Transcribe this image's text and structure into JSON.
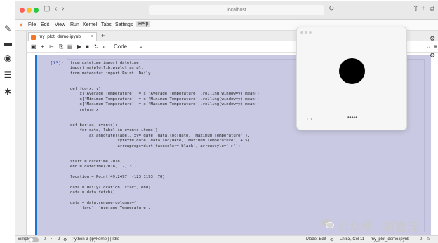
{
  "browser": {
    "address": "localhost"
  },
  "menu": [
    "File",
    "Edit",
    "View",
    "Run",
    "Kernel",
    "Tabs",
    "Settings",
    "Help"
  ],
  "tab": {
    "title": "my_plot_demo.ipynb",
    "close": "×",
    "add": "+"
  },
  "toolbar": {
    "cell_type": "Code"
  },
  "cell": {
    "prompt": "[13]:",
    "lines": [
      "from datetime import datetime",
      "import matplotlib.pyplot as plt",
      "from meteostat import Point, Daily",
      "",
      "",
      "def foo(x, y):",
      "    x['Average Temperature'] = x['Average Temperature'].rolling(window=y).mean()",
      "    x['Minimum Temperature'] = x['Minimum Temperature'].rolling(window=y).mean()",
      "    x['Maximum Temperature'] = x['Maximum Temperature'].rolling(window=y).mean()",
      "    return x",
      "",
      "",
      "def bar(ax, events):",
      "    for date, label in events.items():",
      "        ax.annotate(label, xy=(date, data.loc[date, 'Maximum Temperature']),",
      "                    xytext=(date, data.loc[date, 'Maximum Temperature'] + 5),",
      "                    arrowprops=dict(facecolor='black', arrowstyle='->'))",
      "",
      "",
      "start = datetime(2018, 1, 1)",
      "end = datetime(2018, 12, 31)",
      "",
      "location = Point(49.2497, -123.1193, 70)",
      "",
      "data = Daily(location, start, end)",
      "data = data.fetch()",
      "",
      "data = data.rename(columns={",
      "    'tavg': 'Average Temperature',"
    ]
  },
  "status": {
    "mode_label": "Simple",
    "count_a": "0",
    "count_b": "2",
    "kernel": "Python 3 (ipykernel) | Idle",
    "edit_mode": "Mode: Edit",
    "cursor": "Ln 53, Col 11",
    "file": "my_plot_demo.ipynb",
    "notifications": "0"
  },
  "plot_window": {
    "dots": "•••••"
  },
  "watermark": {
    "text": "公众号 · 新智元"
  },
  "colors": {
    "cell_bg": "#c9c9e3",
    "active_bar": "#1976d2",
    "tab_icon": "#f37726"
  }
}
